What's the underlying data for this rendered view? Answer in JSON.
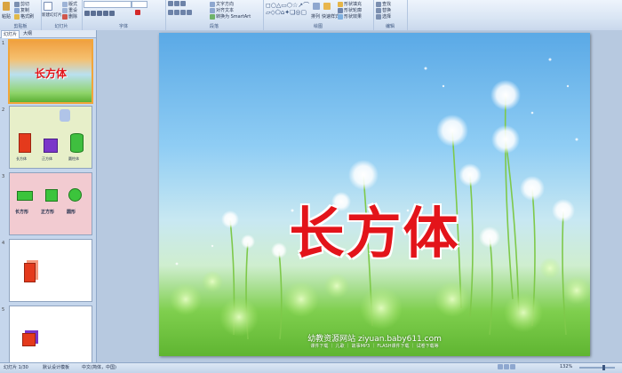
{
  "ribbon": {
    "clipboard": {
      "cut": "剪切",
      "copy": "复制",
      "paste": "粘贴",
      "format_painter": "格式刷",
      "label": "剪贴板"
    },
    "slides": {
      "new_slide": "新建幻灯片",
      "layout": "版式",
      "reset": "重设",
      "delete": "删除",
      "label": "幻灯片"
    },
    "font": {
      "label": "字体"
    },
    "paragraph": {
      "text_direction": "文字方向",
      "align_text": "对齐文本",
      "smartart": "转换为 SmartArt",
      "label": "段落"
    },
    "drawing": {
      "arrange": "排列",
      "quick_styles": "快速样式",
      "shape_fill": "形状填充",
      "shape_outline": "形状轮廓",
      "shape_effects": "形状效果",
      "label": "绘图"
    },
    "editing": {
      "find": "查找",
      "replace": "替换",
      "select": "选择",
      "label": "编辑"
    }
  },
  "left_panel": {
    "tabs": [
      "幻灯片",
      "大纲"
    ],
    "slides": [
      {
        "num": "1",
        "title": "长方体"
      },
      {
        "num": "2",
        "labels": [
          "长方体",
          "正方体",
          "圆柱体"
        ]
      },
      {
        "num": "3",
        "labels": [
          "长方形",
          "正方形",
          "圆形"
        ]
      },
      {
        "num": "4"
      },
      {
        "num": "5"
      }
    ]
  },
  "slide": {
    "title": "长方体",
    "footer_main": "幼教资源网站 ziyuan.baby611.com",
    "footer_sub": "课件下载 ｜ 儿歌 ｜ 故事MP3 ｜ FLASH课件下载 ｜ 试卷下载等"
  },
  "status": {
    "slide_count": "幻灯片 1/30",
    "theme": "默认设计模板",
    "language": "中文(简体，中国)",
    "zoom": "132%"
  },
  "colors": {
    "title_red": "#e3141a",
    "selection": "#f2a53a"
  }
}
